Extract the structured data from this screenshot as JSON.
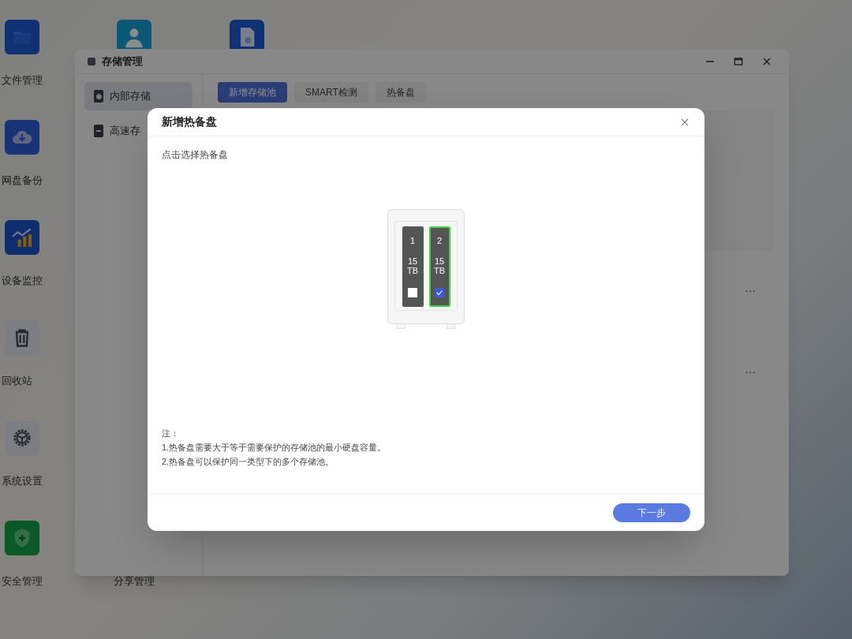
{
  "desktop_icons": [
    {
      "kind": "folder",
      "label": "文件管理"
    },
    {
      "kind": "cloud",
      "label": "网盘备份"
    },
    {
      "kind": "chart",
      "label": "设备监控"
    },
    {
      "kind": "trash",
      "label": "回收站"
    },
    {
      "kind": "gear",
      "label": "系统设置"
    },
    {
      "kind": "shield",
      "label": "安全管理"
    },
    {
      "kind": "user"
    },
    {
      "kind": "document"
    },
    {
      "kind": "hidden",
      "label": "分享管理"
    }
  ],
  "window": {
    "title": "存储管理",
    "sidebar": {
      "items": [
        {
          "label": "内部存储",
          "selected": true,
          "kind": "disk"
        },
        {
          "label": "高速存",
          "selected": false,
          "kind": "ssd"
        }
      ]
    },
    "tabs": [
      {
        "label": "新增存储池",
        "selected": true
      },
      {
        "label": "SMART检测",
        "selected": false
      },
      {
        "label": "热备盘",
        "selected": false
      }
    ],
    "row_menus": [
      "···",
      "···"
    ]
  },
  "dialog": {
    "title": "新增热备盘",
    "instruction": "点击选择热备盘",
    "bays": [
      {
        "number": "1",
        "capacity": "15",
        "unit": "TB",
        "selected": false,
        "checked": false
      },
      {
        "number": "2",
        "capacity": "15",
        "unit": "TB",
        "selected": true,
        "checked": true
      }
    ],
    "notes": [
      "注：",
      "1.热备盘需要大于等于需要保护的存储池的最小硬盘容量。",
      "2.热备盘可以保护同一类型下的多个存储池。"
    ],
    "next_button": "下一步"
  }
}
